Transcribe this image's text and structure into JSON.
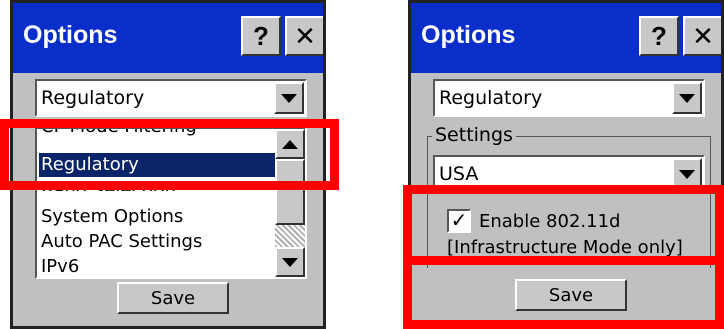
{
  "left_dialog": {
    "title": "Options",
    "help_label": "?",
    "close_label": "✕",
    "category_value": "Regulatory",
    "list_items": [
      {
        "label": "CF Mode Filtering",
        "state": "clipped-top"
      },
      {
        "label": "Regulatory",
        "state": "selected"
      },
      {
        "label": "Band Selection",
        "state": "clipped-bottom"
      },
      {
        "label": "System Options",
        "state": "normal"
      },
      {
        "label": "Auto PAC Settings",
        "state": "normal"
      },
      {
        "label": "IPv6",
        "state": "normal"
      }
    ],
    "save_label": "Save"
  },
  "right_dialog": {
    "title": "Options",
    "help_label": "?",
    "close_label": "✕",
    "category_value": "Regulatory",
    "settings_legend": "Settings",
    "country_value": "USA",
    "enable_80211d_label": "Enable 802.11d",
    "enable_80211d_checked": true,
    "check_mark": "✓",
    "infrastructure_note": "[Infrastructure Mode only]",
    "save_label": "Save"
  },
  "colors": {
    "titlebar": "#0a2ec9",
    "dialog_bg": "#c0c0c0",
    "selection": "#0a246a",
    "highlight": "#ff0000"
  },
  "icons": {
    "help": "help-icon",
    "close": "close-icon",
    "dropdown": "chevron-down-icon",
    "scroll_up": "chevron-up-icon",
    "scroll_down": "chevron-down-icon"
  }
}
